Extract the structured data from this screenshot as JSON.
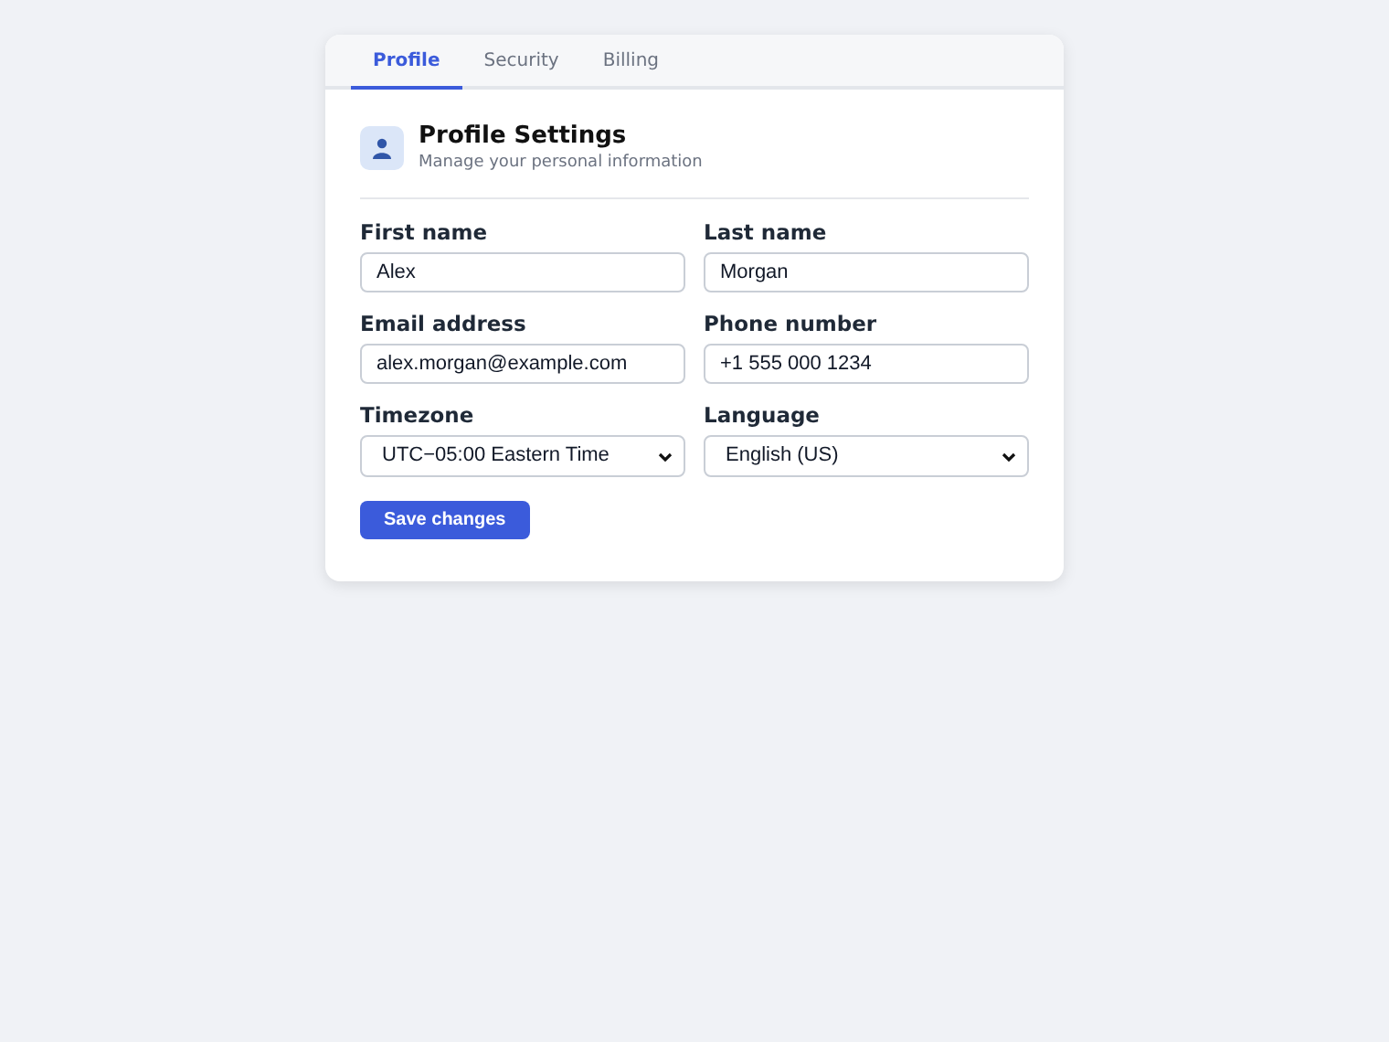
{
  "tabs": [
    {
      "label": "Profile",
      "selected": true
    },
    {
      "label": "Security",
      "selected": false
    },
    {
      "label": "Billing",
      "selected": false
    }
  ],
  "header": {
    "title": "Profile Settings",
    "subtitle": "Manage your personal information"
  },
  "fields": [
    {
      "label": "First name",
      "kind": "input",
      "value": "Alex"
    },
    {
      "label": "Last name",
      "kind": "input",
      "value": "Morgan"
    },
    {
      "label": "Email address",
      "kind": "input",
      "value": "alex.morgan@example.com"
    },
    {
      "label": "Phone number",
      "kind": "input",
      "value": "+1 555 000 1234"
    },
    {
      "label": "Timezone",
      "kind": "select",
      "value": "UTC−05:00 Eastern Time"
    },
    {
      "label": "Language",
      "kind": "select",
      "value": "English (US)"
    }
  ],
  "save_button": "Save changes"
}
